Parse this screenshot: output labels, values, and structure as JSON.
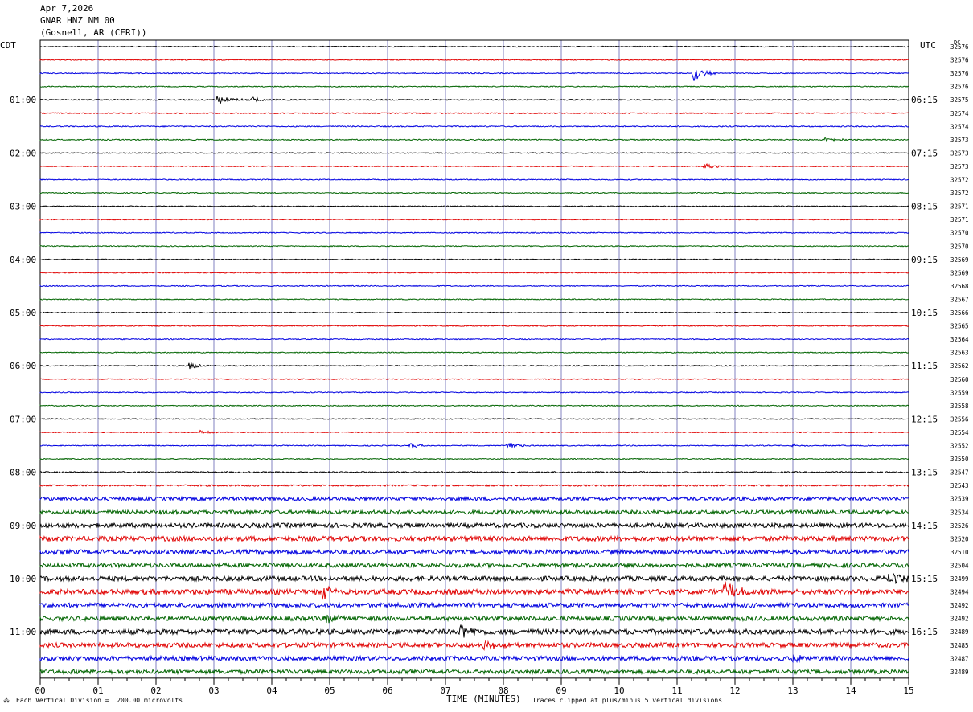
{
  "header": {
    "date": "Apr 7,2026",
    "station": "GNAR HNZ NM 00",
    "location": "(Gosnell, AR (CERI))"
  },
  "corner_labels": {
    "left": "CDT",
    "right": "UTC",
    "dc": "DC"
  },
  "footer": {
    "scale_note": "Each Vertical Division =  200.00 microvolts",
    "clip_note": "Traces clipped at plus/minus 5 vertical divisions",
    "x_title": "TIME (MINUTES)"
  },
  "colors": {
    "trace_cycle": [
      "#000000",
      "#e00000",
      "#0000e0",
      "#006400"
    ],
    "vertical_grid": "#8080c0"
  },
  "chart_data": {
    "type": "line",
    "title": "",
    "xlabel": "TIME (MINUTES)",
    "ylabel": "",
    "xlim": [
      0,
      15
    ],
    "x_ticks": [
      "00",
      "01",
      "02",
      "03",
      "04",
      "05",
      "06",
      "07",
      "08",
      "09",
      "10",
      "11",
      "12",
      "13",
      "14",
      "15"
    ],
    "row_minutes": 15,
    "rows": 48,
    "left_hour_labels": [
      {
        "row": 4,
        "label": "01:00"
      },
      {
        "row": 8,
        "label": "02:00"
      },
      {
        "row": 12,
        "label": "03:00"
      },
      {
        "row": 16,
        "label": "04:00"
      },
      {
        "row": 20,
        "label": "05:00"
      },
      {
        "row": 24,
        "label": "06:00"
      },
      {
        "row": 28,
        "label": "07:00"
      },
      {
        "row": 32,
        "label": "08:00"
      },
      {
        "row": 36,
        "label": "09:00"
      },
      {
        "row": 40,
        "label": "10:00"
      },
      {
        "row": 44,
        "label": "11:00"
      }
    ],
    "right_hour_labels": [
      {
        "row": 4,
        "label": "06:15"
      },
      {
        "row": 8,
        "label": "07:15"
      },
      {
        "row": 12,
        "label": "08:15"
      },
      {
        "row": 16,
        "label": "09:15"
      },
      {
        "row": 20,
        "label": "10:15"
      },
      {
        "row": 24,
        "label": "11:15"
      },
      {
        "row": 28,
        "label": "12:15"
      },
      {
        "row": 32,
        "label": "13:15"
      },
      {
        "row": 36,
        "label": "14:15"
      },
      {
        "row": 40,
        "label": "15:15"
      },
      {
        "row": 44,
        "label": "16:15"
      }
    ],
    "dc_offsets": [
      "32576",
      "32576",
      "32576",
      "32576",
      "32575",
      "32574",
      "32574",
      "32573",
      "32573",
      "32573",
      "32572",
      "32572",
      "32571",
      "32571",
      "32570",
      "32570",
      "32569",
      "32569",
      "32568",
      "32567",
      "32566",
      "32565",
      "32564",
      "32563",
      "32562",
      "32560",
      "32559",
      "32558",
      "32556",
      "32554",
      "32552",
      "32550",
      "32547",
      "32543",
      "32539",
      "32534",
      "32526",
      "32520",
      "32510",
      "32504",
      "32499",
      "32494",
      "32492",
      "32492",
      "32489",
      "32485",
      "32487",
      "32489"
    ],
    "trace_noise_level": [
      0.6,
      0.6,
      0.6,
      0.6,
      0.7,
      0.7,
      0.7,
      0.7,
      0.6,
      0.6,
      0.6,
      0.6,
      0.6,
      0.6,
      0.6,
      0.6,
      0.6,
      0.6,
      0.6,
      0.6,
      0.6,
      0.6,
      0.6,
      0.6,
      0.6,
      0.6,
      0.6,
      0.6,
      0.6,
      0.6,
      0.6,
      0.6,
      0.9,
      1.0,
      2.2,
      2.4,
      2.8,
      3.0,
      2.8,
      2.6,
      3.0,
      3.2,
      2.8,
      2.8,
      3.2,
      2.8,
      2.8,
      2.6
    ],
    "events": [
      {
        "row": 2,
        "minute": 11.3,
        "amplitude": 10
      },
      {
        "row": 4,
        "minute": 3.1,
        "amplitude": 6
      },
      {
        "row": 4,
        "minute": 3.7,
        "amplitude": 3
      },
      {
        "row": 7,
        "minute": 13.6,
        "amplitude": 4
      },
      {
        "row": 9,
        "minute": 11.5,
        "amplitude": 3
      },
      {
        "row": 24,
        "minute": 2.6,
        "amplitude": 4
      },
      {
        "row": 29,
        "minute": 2.8,
        "amplitude": 3
      },
      {
        "row": 30,
        "minute": 6.4,
        "amplitude": 3
      },
      {
        "row": 30,
        "minute": 8.1,
        "amplitude": 5
      },
      {
        "row": 30,
        "minute": 13.0,
        "amplitude": 2
      },
      {
        "row": 41,
        "minute": 11.85,
        "amplitude": 14
      },
      {
        "row": 41,
        "minute": 4.9,
        "amplitude": 8
      },
      {
        "row": 40,
        "minute": 14.7,
        "amplitude": 9
      },
      {
        "row": 44,
        "minute": 7.3,
        "amplitude": 9
      },
      {
        "row": 45,
        "minute": 7.7,
        "amplitude": 6
      },
      {
        "row": 46,
        "minute": 13.0,
        "amplitude": 6
      },
      {
        "row": 43,
        "minute": 4.95,
        "amplitude": 8
      }
    ]
  }
}
